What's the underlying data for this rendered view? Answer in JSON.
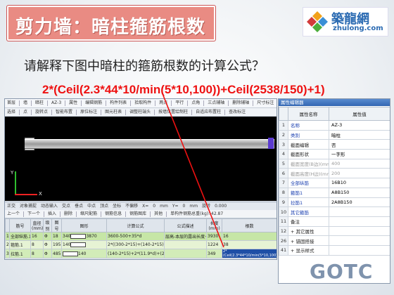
{
  "slide": {
    "title": "剪力墙：暗柱箍筋根数",
    "question": "请解释下图中暗柱的箍筋根数的计算公式？",
    "formula": "2*(Ceil(2.3*44*10/min(5*10,100))+Ceil(2538/150)+1)",
    "watermark": "GOTC"
  },
  "logo": {
    "cn": "築龍網",
    "en": "zhulong.com"
  },
  "app": {
    "toolbar1": [
      "首层",
      "墙",
      "暗柱",
      "AZ-3",
      "属性",
      "编辑钢筋",
      "构件列表",
      "拾取构件",
      "两点",
      "平行",
      "点角",
      "三点辅轴",
      "删除辅轴",
      "尺寸标注"
    ],
    "toolbar2": [
      "选择",
      "点",
      "旋转点",
      "智能布置",
      "原位标注",
      "图元柱表",
      "调整柱端头",
      "按墙位置绘制柱",
      "自适应布置柱",
      "查改标注"
    ],
    "axis_labels": {
      "y": "Y",
      "x": "X"
    },
    "bottombar": [
      "正交",
      "对象捕捉",
      "动态输入",
      "交点",
      "垂点",
      "中点",
      "顶点",
      "坐标",
      "不偏移",
      "X=",
      "0",
      "mm",
      "Y=",
      "0",
      "mm",
      "旋转",
      "0.000"
    ],
    "gridbar": [
      "上一个",
      "下一个",
      "插入",
      "删除",
      "缩尺配筋",
      "钢筋信息",
      "钢筋图库",
      "其他",
      "单构件钢筋总重(kg): 42.87"
    ],
    "grid_headers": [
      "筋号",
      "直径(mm)",
      "级别",
      "图号",
      "图形",
      "计算公式",
      "公式描述",
      "长度(mm)",
      "根数"
    ],
    "grid_rows": [
      {
        "idx": "1",
        "name": "全部纵筋.1",
        "dia": "16",
        "grade": "Φ",
        "fig": "18",
        "shape_l": "340",
        "shape_r": "3870",
        "formula": "3600-500+35*d",
        "desc": "层高-本层的露出长度+锚固",
        "len": "3930",
        "count": "16"
      },
      {
        "idx": "2",
        "name": "箍筋.1",
        "dia": "8",
        "grade": "Φ",
        "fig": "195",
        "shape_l": "140",
        "shape_r": "",
        "formula": "2*((300-2*15)+(140-2*15))+2*(11.9*d)",
        "desc": "",
        "len": "1224",
        "count": "38"
      },
      {
        "idx": "3",
        "name": "拉筋.1",
        "dia": "8",
        "grade": "Φ",
        "fig": "485",
        "shape_l": "",
        "shape_r": "140",
        "formula": "(140-2*15)+2*(11.9*d)+(2*d)",
        "desc": "",
        "len": "349",
        "count": "2*(Ceil(2.3*44*10/min(5*10,100))+Ceil(2538/150)+1)"
      }
    ]
  },
  "props": {
    "title": "属性编辑器",
    "headers": [
      "属性名称",
      "属性值"
    ],
    "rows": [
      {
        "idx": "1",
        "name": "名称",
        "value": "AZ-3",
        "kind": "hl"
      },
      {
        "idx": "2",
        "name": "类别",
        "value": "暗柱",
        "kind": "hl"
      },
      {
        "idx": "3",
        "name": "截面编辑",
        "value": "否",
        "kind": "normal"
      },
      {
        "idx": "4",
        "name": "截面形状",
        "value": "一字形",
        "kind": "normal"
      },
      {
        "idx": "5",
        "name": "截面宽度(B边)(mm)",
        "value": "400",
        "kind": "gray"
      },
      {
        "idx": "6",
        "name": "截面高度(H边)(mm)",
        "value": "200",
        "kind": "gray"
      },
      {
        "idx": "7",
        "name": "全部纵筋",
        "value": "16B10",
        "kind": "hl"
      },
      {
        "idx": "8",
        "name": "箍筋1",
        "value": "A8B150",
        "kind": "hl"
      },
      {
        "idx": "9",
        "name": "拉筋1",
        "value": "2A8B150",
        "kind": "hl"
      },
      {
        "idx": "10",
        "name": "其它箍筋",
        "value": "",
        "kind": "hl"
      },
      {
        "idx": "11",
        "name": "备注",
        "value": "",
        "kind": "normal"
      },
      {
        "idx": "12",
        "name": "+ 其它属性",
        "value": "",
        "kind": "normal"
      },
      {
        "idx": "26",
        "name": "+ 锚固搭接",
        "value": "",
        "kind": "normal"
      },
      {
        "idx": "41",
        "name": "+ 显示样式",
        "value": "",
        "kind": "normal"
      }
    ]
  },
  "colors": {
    "formula": "#e11111",
    "title_bg": "#e98b83",
    "selection": "#1e4fa6"
  }
}
